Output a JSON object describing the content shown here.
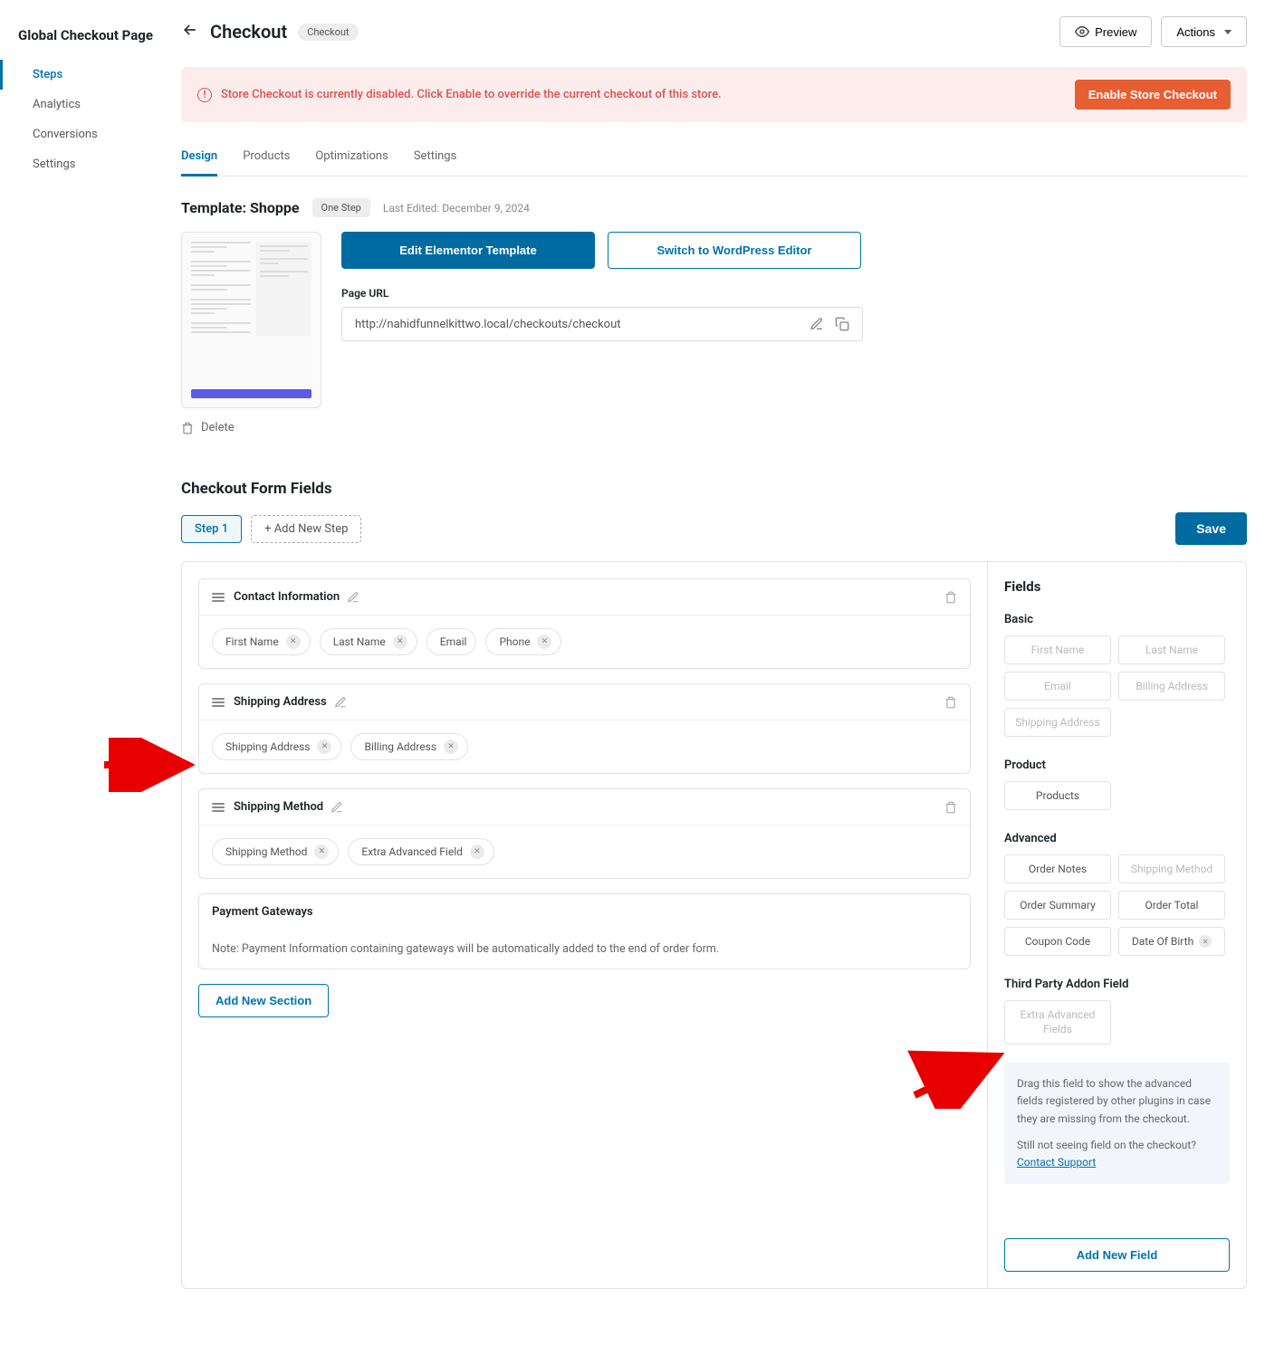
{
  "sidebar": {
    "title": "Global Checkout Page",
    "items": [
      {
        "label": "Steps",
        "active": true
      },
      {
        "label": "Analytics"
      },
      {
        "label": "Conversions"
      },
      {
        "label": "Settings"
      }
    ]
  },
  "topbar": {
    "title": "Checkout",
    "breadcrumb": "Checkout",
    "preview": "Preview",
    "actions": "Actions"
  },
  "alert": {
    "text": "Store Checkout is currently disabled. Click Enable to override the current checkout of this store.",
    "cta": "Enable Store Checkout"
  },
  "tabs": [
    "Design",
    "Products",
    "Optimizations",
    "Settings"
  ],
  "template": {
    "title": "Template: Shoppe",
    "variant": "One Step",
    "last_edited": "Last Edited: December 9, 2024",
    "delete": "Delete",
    "edit_elementor": "Edit Elementor Template",
    "switch_wp": "Switch to WordPress Editor",
    "url_label": "Page URL",
    "url": "http://nahidfunnelkittwo.local/checkouts/checkout"
  },
  "form_fields": {
    "title": "Checkout Form Fields",
    "step1": "Step 1",
    "add_step": "+ Add New Step",
    "save": "Save",
    "sections": [
      {
        "title": "Contact Information",
        "chips": [
          "First Name",
          "Last Name",
          "Email",
          "Phone"
        ]
      },
      {
        "title": "Shipping Address",
        "chips": [
          "Shipping Address",
          "Billing Address"
        ]
      },
      {
        "title": "Shipping Method",
        "chips": [
          "Shipping Method",
          "Extra Advanced Field"
        ]
      }
    ],
    "payment": {
      "title": "Payment Gateways",
      "note": "Note: Payment Information containing gateways will be automatically added to the end of order form."
    },
    "add_section": "Add New Section"
  },
  "fields_panel": {
    "title": "Fields",
    "groups": {
      "basic": {
        "title": "Basic",
        "items": [
          {
            "label": "First Name",
            "disabled": true
          },
          {
            "label": "Last Name",
            "disabled": true
          },
          {
            "label": "Email",
            "disabled": true
          },
          {
            "label": "Billing Address",
            "disabled": true
          },
          {
            "label": "Shipping Address",
            "disabled": true
          }
        ]
      },
      "product": {
        "title": "Product",
        "items": [
          {
            "label": "Products"
          }
        ]
      },
      "advanced": {
        "title": "Advanced",
        "items": [
          {
            "label": "Order Notes"
          },
          {
            "label": "Shipping Method",
            "disabled": true
          },
          {
            "label": "Order Summary"
          },
          {
            "label": "Order Total"
          },
          {
            "label": "Coupon Code"
          },
          {
            "label": "Date Of Birth",
            "removable": true
          }
        ]
      },
      "third_party": {
        "title": "Third Party Addon Field",
        "items": [
          {
            "label": "Extra Advanced Fields",
            "disabled": true
          }
        ]
      }
    },
    "info_text": "Drag this field to show the advanced fields registered by other plugins in case they are missing from the checkout.",
    "info_question": "Still not seeing field on the checkout?",
    "info_link": "Contact Support",
    "add_field": "Add New Field"
  }
}
